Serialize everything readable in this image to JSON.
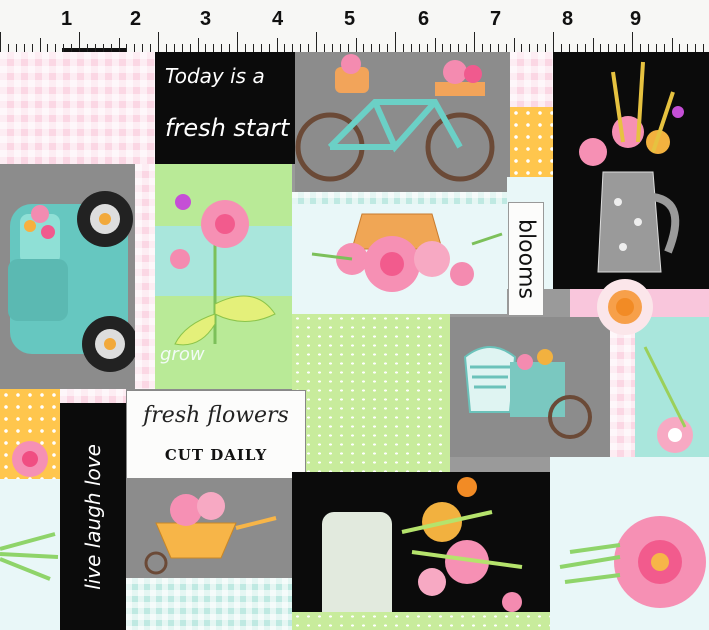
{
  "ruler": {
    "numbers": [
      "1",
      "2",
      "3",
      "4",
      "5",
      "6",
      "7",
      "8",
      "9"
    ]
  },
  "labels": {
    "today_line1": "Today is a",
    "today_line2": "fresh start",
    "blooms": "blooms",
    "grow": "grow",
    "fresh_flowers": "fresh flowers",
    "cut_daily": "CUT DAILY",
    "live_laugh_love": "live laugh love"
  },
  "colors": {
    "black_panel": "#0b0b0b",
    "gray_panel": "#8c8c8c",
    "mint": "#a9e6dc",
    "pink": "#f9c6dc",
    "green": "#b9ea97",
    "truck": "#66c7c0",
    "bicycle": "#6bd0c6",
    "orange": "#ffc64d"
  },
  "icons": [
    "truck-icon",
    "bicycle-icon",
    "flower-bouquet-icon",
    "pitcher-icon",
    "flower-cart-icon",
    "wheelbarrow-icon",
    "mason-jar-icon",
    "daisy-icon"
  ]
}
